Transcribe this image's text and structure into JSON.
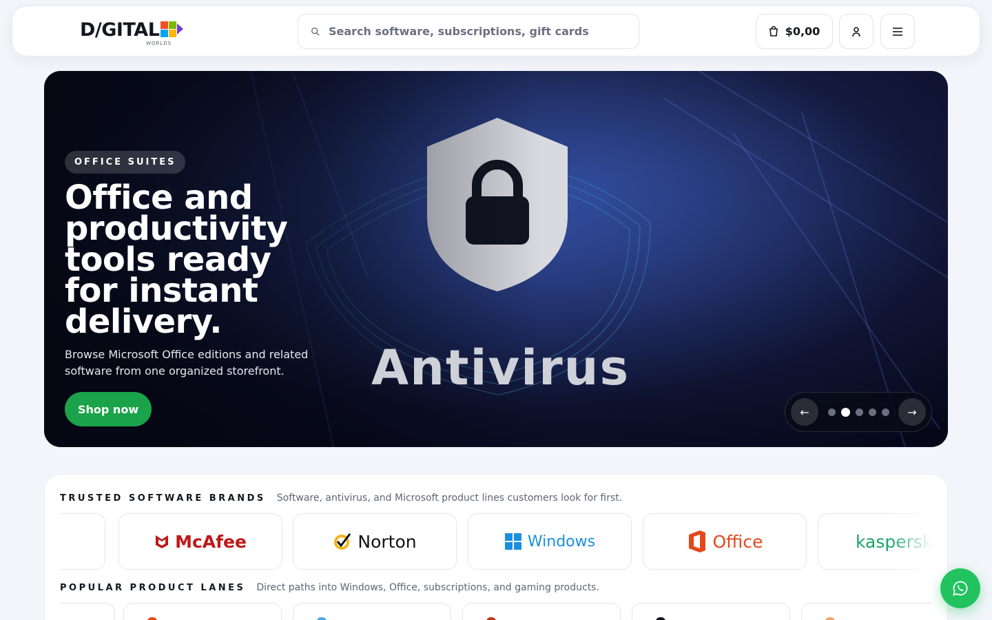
{
  "header": {
    "logo_text": "D/GITAL",
    "logo_sub": "WORLDS",
    "search_placeholder": "Search software, subscriptions, gift cards",
    "cart_total": "$0,00",
    "icons": [
      "search-icon",
      "bag-icon",
      "user-icon",
      "menu-icon"
    ]
  },
  "hero": {
    "badge": "OFFICE SUITES",
    "title": "Office and productivity tools ready for instant delivery.",
    "description": "Browse Microsoft Office editions and related software from one organized storefront.",
    "cta": "Shop now",
    "image_word": "Antivirus",
    "carousel": {
      "prev": "←",
      "next": "→",
      "slide_count": 5,
      "active_index": 1
    }
  },
  "brands": {
    "title": "TRUSTED SOFTWARE BRANDS",
    "subtitle": "Software, antivirus, and Microsoft product lines customers look for first.",
    "items": [
      {
        "name": "McAfee",
        "color": "#c01818"
      },
      {
        "name": "Norton",
        "color": "#111111"
      },
      {
        "name": "Windows",
        "color": "#1a8fe0"
      },
      {
        "name": "Office",
        "color": "#e5481b"
      },
      {
        "name": "kaspersky",
        "color": "#1aa36b"
      }
    ]
  },
  "lanes": {
    "title": "POPULAR PRODUCT LANES",
    "subtitle": "Direct paths into Windows, Office, subscriptions, and gaming products."
  },
  "colors": {
    "accent_green": "#1aa34a",
    "whatsapp": "#22c35e"
  }
}
